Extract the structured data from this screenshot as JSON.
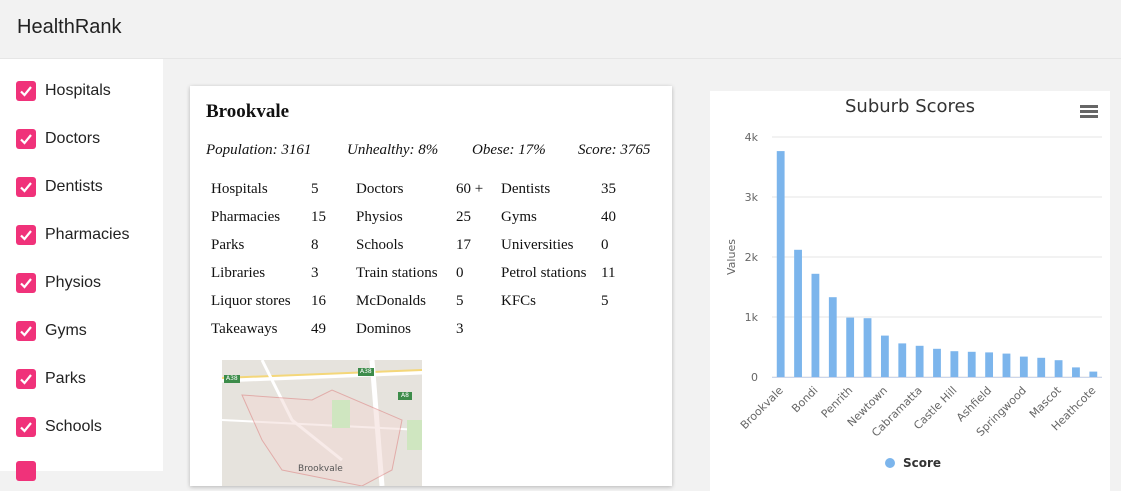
{
  "header": {
    "title": "HealthRank"
  },
  "sidebar": {
    "filters": [
      {
        "label": "Hospitals",
        "checked": true
      },
      {
        "label": "Doctors",
        "checked": true
      },
      {
        "label": "Dentists",
        "checked": true
      },
      {
        "label": "Pharmacies",
        "checked": true
      },
      {
        "label": "Physios",
        "checked": true
      },
      {
        "label": "Gyms",
        "checked": true
      },
      {
        "label": "Parks",
        "checked": true
      },
      {
        "label": "Schools",
        "checked": true
      }
    ],
    "checkbox_color": "#f0327a"
  },
  "suburb": {
    "name": "Brookvale",
    "stats": {
      "population": "Population: 3161",
      "unhealthy": "Unhealthy: 8%",
      "obese": "Obese: 17%",
      "score": "Score: 3765"
    },
    "facilities": [
      [
        {
          "label": "Hospitals",
          "value": "5"
        },
        {
          "label": "Doctors",
          "value": "60 +"
        },
        {
          "label": "Dentists",
          "value": "35"
        }
      ],
      [
        {
          "label": "Pharmacies",
          "value": "15"
        },
        {
          "label": "Physios",
          "value": "25"
        },
        {
          "label": "Gyms",
          "value": "40"
        }
      ],
      [
        {
          "label": "Parks",
          "value": "8"
        },
        {
          "label": "Schools",
          "value": "17"
        },
        {
          "label": "Universities",
          "value": "0"
        }
      ],
      [
        {
          "label": "Libraries",
          "value": "3"
        },
        {
          "label": "Train stations",
          "value": "0"
        },
        {
          "label": "Petrol stations",
          "value": "11"
        }
      ],
      [
        {
          "label": "Liquor stores",
          "value": "16"
        },
        {
          "label": "McDonalds",
          "value": "5"
        },
        {
          "label": "KFCs",
          "value": "5"
        }
      ],
      [
        {
          "label": "Takeaways",
          "value": "49"
        },
        {
          "label": "Dominos",
          "value": "3"
        }
      ]
    ],
    "map": {
      "labels": {
        "road_a": "A38",
        "road_b": "A38",
        "road_c": "A8",
        "place": "Brookvale"
      }
    }
  },
  "chart_data": {
    "type": "bar",
    "title": "Suburb Scores",
    "ylabel": "Values",
    "xlabel": "",
    "ylim": [
      0,
      4000
    ],
    "yticks": [
      0,
      1000,
      2000,
      3000,
      4000
    ],
    "ytick_labels": [
      "0",
      "1k",
      "2k",
      "3k",
      "4k"
    ],
    "categories": [
      "Brookvale",
      "",
      "Bondi",
      "",
      "Penrith",
      "",
      "Newtown",
      "",
      "Cabramatta",
      "",
      "Castle Hill",
      "",
      "Ashfield",
      "",
      "Springwood",
      "",
      "Mascot",
      "",
      "Heathcote"
    ],
    "series": [
      {
        "name": "Score",
        "color": "#7cb5ec",
        "values": [
          3765,
          2120,
          1720,
          1330,
          990,
          980,
          690,
          560,
          520,
          470,
          430,
          420,
          410,
          390,
          340,
          320,
          280,
          160,
          90
        ]
      }
    ],
    "legend": "bottom-center"
  }
}
